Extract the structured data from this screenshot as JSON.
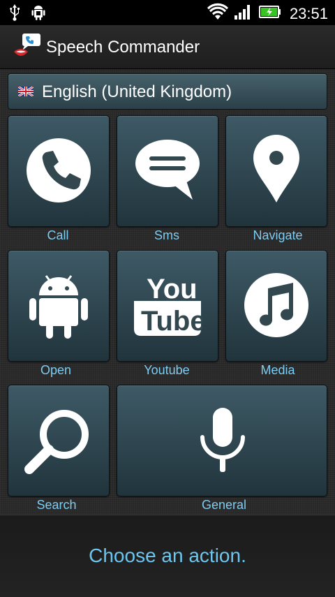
{
  "status_bar": {
    "time": "23:51",
    "icons": [
      "usb-icon",
      "android-debug-icon",
      "wifi-icon",
      "signal-icon",
      "battery-charging-icon"
    ]
  },
  "app": {
    "title": "Speech Commander",
    "icon": "speech-bubble-mouth-icon"
  },
  "language": {
    "label": "English (United Kingdom)",
    "flag": "uk-flag-icon"
  },
  "actions": [
    {
      "label": "Call",
      "icon": "phone-icon"
    },
    {
      "label": "Sms",
      "icon": "message-icon"
    },
    {
      "label": "Navigate",
      "icon": "map-pin-icon"
    },
    {
      "label": "Open",
      "icon": "android-icon"
    },
    {
      "label": "Youtube",
      "icon": "youtube-icon"
    },
    {
      "label": "Media",
      "icon": "music-note-icon"
    },
    {
      "label": "Search",
      "icon": "search-icon"
    },
    {
      "label": "General",
      "icon": "microphone-icon"
    }
  ],
  "footer": {
    "message": "Choose an action."
  },
  "colors": {
    "accent": "#7ecdf3",
    "tile_top": "#3e5a66",
    "tile_bottom": "#21343c"
  }
}
